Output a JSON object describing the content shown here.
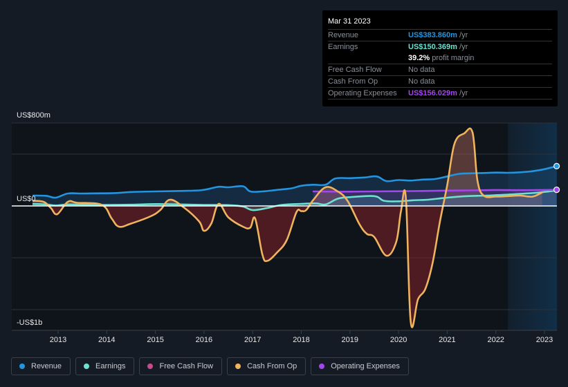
{
  "tooltip": {
    "date": "Mar 31 2023",
    "rows": [
      {
        "label": "Revenue",
        "value": "US$383.860m",
        "suffix": " /yr",
        "color": "#2394df"
      },
      {
        "label": "Earnings",
        "value": "US$150.369m",
        "suffix": " /yr",
        "color": "#6ee0d1"
      },
      {
        "label": "",
        "value": "39.2%",
        "suffix": " profit margin",
        "color": "#ffffff"
      },
      {
        "label": "Free Cash Flow",
        "value": "",
        "suffix": "No data",
        "color": "#8a8f98"
      },
      {
        "label": "Cash From Op",
        "value": "",
        "suffix": "No data",
        "color": "#8a8f98"
      },
      {
        "label": "Operating Expenses",
        "value": "US$156.029m",
        "suffix": " /yr",
        "color": "#a346eb"
      }
    ]
  },
  "legend": [
    {
      "label": "Revenue",
      "color": "#2394df"
    },
    {
      "label": "Earnings",
      "color": "#6ee0d1"
    },
    {
      "label": "Free Cash Flow",
      "color": "#c64b8a"
    },
    {
      "label": "Cash From Op",
      "color": "#f0b35e"
    },
    {
      "label": "Operating Expenses",
      "color": "#a346eb"
    }
  ],
  "chart_data": {
    "type": "line",
    "title": "",
    "xlabel": "",
    "ylabel": "",
    "y_tick_labels": [
      "US$800m",
      "US$0",
      "-US$1b"
    ],
    "y_tick_values": [
      800,
      0,
      -1000
    ],
    "gridlines_at": [
      800,
      500,
      0,
      -500,
      -1000
    ],
    "x_ticks": [
      2013,
      2014,
      2015,
      2016,
      2017,
      2018,
      2019,
      2020,
      2021,
      2022,
      2023
    ],
    "xlim": [
      2012.45,
      2023.25
    ],
    "ylim": [
      -1200,
      800
    ],
    "units": "US$ millions",
    "forecast_shading_from": 2022.25,
    "grid": true,
    "legend_position": "bottom",
    "series": [
      {
        "name": "Revenue",
        "color": "#2394df",
        "fill": true,
        "x": [
          2012.45,
          2012.75,
          2012.95,
          2013.2,
          2013.5,
          2013.9,
          2014.2,
          2014.5,
          2015.0,
          2015.5,
          2015.9,
          2016.1,
          2016.3,
          2016.5,
          2016.8,
          2016.95,
          2017.2,
          2017.5,
          2017.8,
          2018.0,
          2018.25,
          2018.5,
          2018.7,
          2019.0,
          2019.3,
          2019.55,
          2019.75,
          2020.0,
          2020.25,
          2020.5,
          2020.75,
          2021.0,
          2021.25,
          2021.5,
          2021.75,
          2022.0,
          2022.25,
          2022.5,
          2022.75,
          2023.0,
          2023.25
        ],
        "values": [
          100,
          98,
          80,
          120,
          120,
          122,
          125,
          135,
          140,
          145,
          150,
          165,
          185,
          180,
          190,
          140,
          140,
          155,
          170,
          195,
          205,
          205,
          265,
          268,
          275,
          285,
          240,
          250,
          245,
          255,
          260,
          285,
          310,
          315,
          318,
          322,
          320,
          325,
          335,
          355,
          384
        ]
      },
      {
        "name": "Earnings",
        "color": "#6ee0d1",
        "fill": true,
        "x": [
          2012.45,
          2012.75,
          2012.95,
          2013.2,
          2013.5,
          2014.0,
          2014.5,
          2015.0,
          2015.5,
          2016.0,
          2016.5,
          2016.8,
          2017.0,
          2017.3,
          2017.6,
          2018.0,
          2018.3,
          2018.5,
          2018.75,
          2019.0,
          2019.5,
          2019.7,
          2020.0,
          2020.3,
          2020.6,
          2021.0,
          2021.4,
          2021.8,
          2022.25,
          2022.6,
          2022.9,
          2023.25
        ],
        "values": [
          20,
          15,
          5,
          15,
          12,
          10,
          12,
          18,
          15,
          10,
          8,
          -5,
          -40,
          -20,
          10,
          20,
          25,
          15,
          70,
          85,
          95,
          50,
          45,
          55,
          60,
          80,
          95,
          100,
          110,
          120,
          130,
          150
        ]
      },
      {
        "name": "Cash From Op",
        "color": "#f0b35e",
        "fill": true,
        "x": [
          2012.45,
          2012.7,
          2012.85,
          2012.98,
          2013.2,
          2013.4,
          2013.9,
          2014.1,
          2014.25,
          2014.5,
          2014.9,
          2015.1,
          2015.3,
          2015.6,
          2015.9,
          2016.0,
          2016.15,
          2016.3,
          2016.5,
          2016.8,
          2016.95,
          2017.05,
          2017.2,
          2017.3,
          2017.5,
          2017.7,
          2017.9,
          2018.0,
          2018.1,
          2018.25,
          2018.5,
          2018.75,
          2018.95,
          2019.2,
          2019.35,
          2019.5,
          2019.75,
          2019.95,
          2020.05,
          2020.15,
          2020.25,
          2020.4,
          2020.55,
          2020.7,
          2020.85,
          2021.0,
          2021.15,
          2021.35,
          2021.52,
          2021.62,
          2021.75,
          2022.0,
          2022.25,
          2022.5,
          2022.75,
          2022.95
        ],
        "values": [
          50,
          40,
          -20,
          -80,
          40,
          30,
          10,
          -120,
          -200,
          -170,
          -100,
          -40,
          60,
          -20,
          -150,
          -240,
          -170,
          20,
          -110,
          -200,
          -210,
          -120,
          -470,
          -530,
          -450,
          -330,
          -60,
          -50,
          -40,
          60,
          180,
          140,
          50,
          -180,
          -270,
          -300,
          -480,
          -350,
          -50,
          80,
          -1120,
          -900,
          -800,
          -550,
          -150,
          200,
          600,
          700,
          710,
          250,
          100,
          90,
          95,
          100,
          90,
          130
        ]
      },
      {
        "name": "Operating Expenses",
        "color": "#a346eb",
        "fill": true,
        "x": [
          2018.25,
          2018.6,
          2019.0,
          2019.5,
          2020.0,
          2020.5,
          2021.0,
          2021.5,
          2022.0,
          2022.5,
          2023.0,
          2023.25
        ],
        "values": [
          140,
          138,
          138,
          140,
          142,
          145,
          148,
          150,
          154,
          152,
          154,
          156
        ]
      }
    ]
  }
}
